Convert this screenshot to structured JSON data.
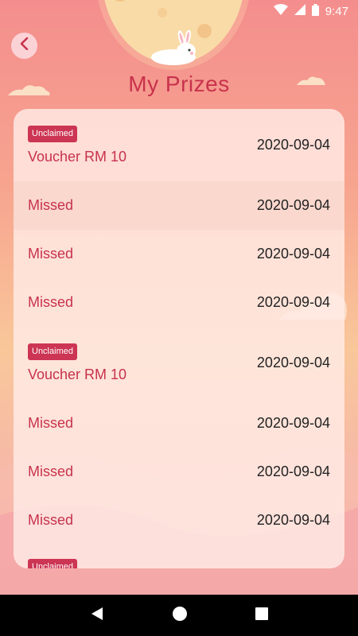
{
  "status": {
    "time": "9:47"
  },
  "header": {
    "title": "My Prizes"
  },
  "prizes": [
    {
      "badge": "Unclaimed",
      "name": "Voucher RM 10",
      "date": "2020-09-04"
    },
    {
      "name": "Missed",
      "date": "2020-09-04"
    },
    {
      "name": "Missed",
      "date": "2020-09-04"
    },
    {
      "name": "Missed",
      "date": "2020-09-04"
    },
    {
      "badge": "Unclaimed",
      "name": "Voucher RM 10",
      "date": "2020-09-04"
    },
    {
      "name": "Missed",
      "date": "2020-09-04"
    },
    {
      "name": "Missed",
      "date": "2020-09-04"
    },
    {
      "name": "Missed",
      "date": "2020-09-04"
    },
    {
      "badge": "Unclaimed"
    }
  ],
  "colors": {
    "accent": "#c8324c",
    "badge": "#cc3553",
    "moon": "#f9dba8"
  },
  "icons": {
    "back": "chevron-left-icon",
    "wifi": "wifi-icon",
    "signal": "signal-icon",
    "battery": "battery-icon",
    "nav_back": "triangle-back-icon",
    "nav_home": "circle-home-icon",
    "nav_recents": "square-recents-icon"
  }
}
